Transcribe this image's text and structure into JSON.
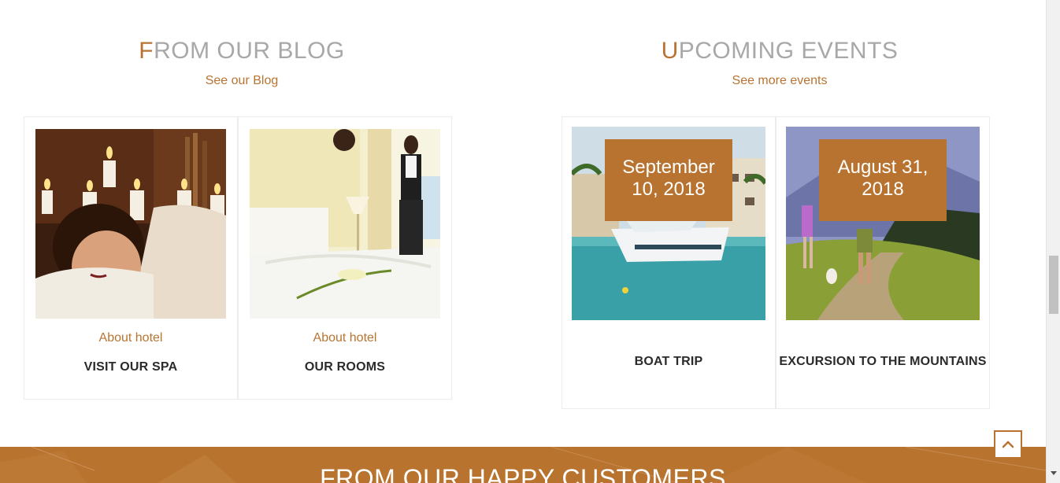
{
  "blog": {
    "heading_first": "F",
    "heading_rest": "ROM OUR BLOG",
    "link": "See our Blog",
    "posts": [
      {
        "category": "About hotel",
        "title": "VISIT OUR SPA",
        "image": "spa-photo"
      },
      {
        "category": "About hotel",
        "title": "OUR ROOMS",
        "image": "hotel-room-photo"
      }
    ]
  },
  "events": {
    "heading_first": "U",
    "heading_rest": "PCOMING EVENTS",
    "link": "See more events",
    "items": [
      {
        "date_line1": "September",
        "date_line2": "10, 2018",
        "title": "BOAT TRIP",
        "image": "yacht-marina-photo"
      },
      {
        "date_line1": "August 31,",
        "date_line2": "2018",
        "title": "EXCURSION TO THE MOUNTAINS",
        "image": "mountain-hikers-photo"
      }
    ]
  },
  "testimonials": {
    "title": "FROM OUR HAPPY CUSTOMERS"
  },
  "back_to_top": {
    "icon": "chevron-up-icon"
  },
  "colors": {
    "accent": "#b97330",
    "heading_gray": "#a8a8a8",
    "title_dark": "#2b2b2b"
  }
}
